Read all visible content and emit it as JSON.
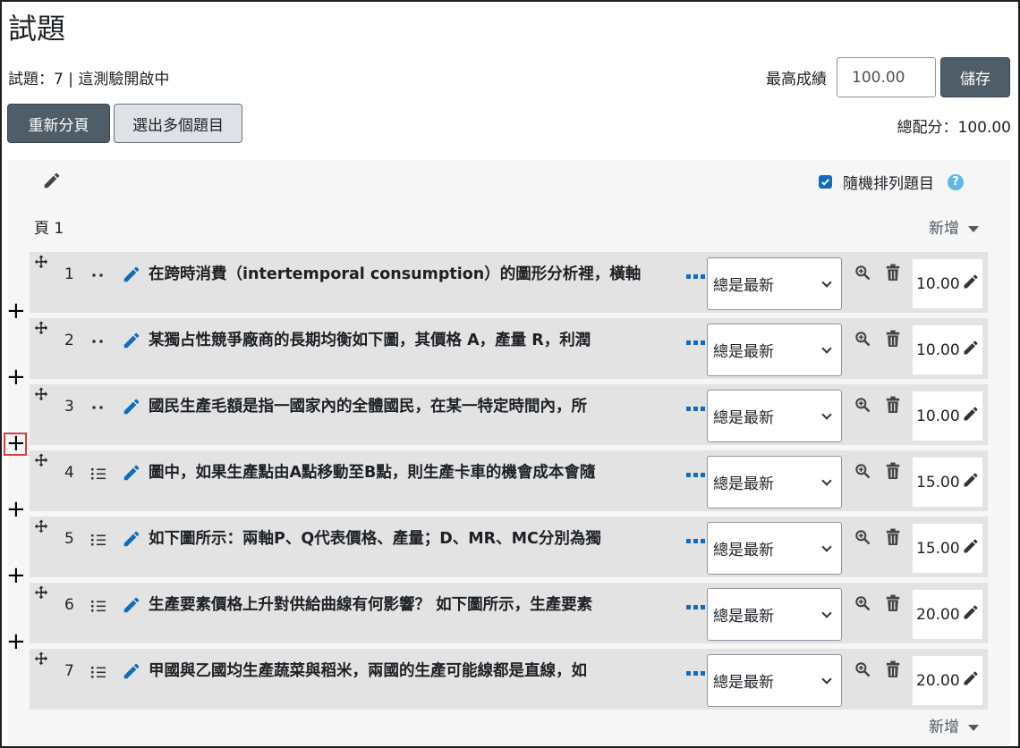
{
  "page": {
    "title": "試題",
    "info": "試題：7 | 這測驗開啟中",
    "max_grade_label": "最高成績",
    "max_grade_value": "100.00",
    "save_label": "儲存",
    "repaginate_label": "重新分頁",
    "select_multiple_label": "選出多個題目",
    "total_marks": "總配分：100.00"
  },
  "section": {
    "shuffle_label": "隨機排列題目",
    "shuffle_checked": true,
    "page_label": "頁 1",
    "add_label": "新增",
    "add_label_bottom": "新增"
  },
  "questions": [
    {
      "number": "1",
      "type_icon": "description-icon",
      "text": "在跨時消費（intertemporal consumption）的圖形分析裡，橫軸",
      "version": "總是最新",
      "mark": "10.00"
    },
    {
      "number": "2",
      "type_icon": "description-icon",
      "text": "某獨占性競爭廠商的長期均衡如下圖，其價格 A，產量 R，利潤",
      "version": "總是最新",
      "mark": "10.00"
    },
    {
      "number": "3",
      "type_icon": "description-icon",
      "text": "國民生產毛額是指一國家內的全體國民，在某一特定時間內，所",
      "version": "總是最新",
      "mark": "10.00"
    },
    {
      "number": "4",
      "type_icon": "multichoice-icon",
      "text": "圖中，如果生產點由A點移動至B點，則生產卡車的機會成本會隨",
      "version": "總是最新",
      "mark": "15.00"
    },
    {
      "number": "5",
      "type_icon": "multichoice-icon",
      "text": "如下圖所示：兩軸P、Q代表價格、產量；D、MR、MC分別為獨",
      "version": "總是最新",
      "mark": "15.00"
    },
    {
      "number": "6",
      "type_icon": "multichoice-icon",
      "text": "生產要素價格上升對供給曲線有何影響？ 如下圖所示，生產要素",
      "version": "總是最新",
      "mark": "20.00"
    },
    {
      "number": "7",
      "type_icon": "multichoice-icon",
      "text": "甲國與乙國均生產蔬菜與稻米，兩國的生產可能線都是直線，如",
      "version": "總是最新",
      "mark": "20.00"
    }
  ],
  "colors": {
    "accent": "#0f6cbf",
    "button_dark": "#4e5d67",
    "slot_bg": "#e3e3e3",
    "highlight": "#e03a3a"
  }
}
